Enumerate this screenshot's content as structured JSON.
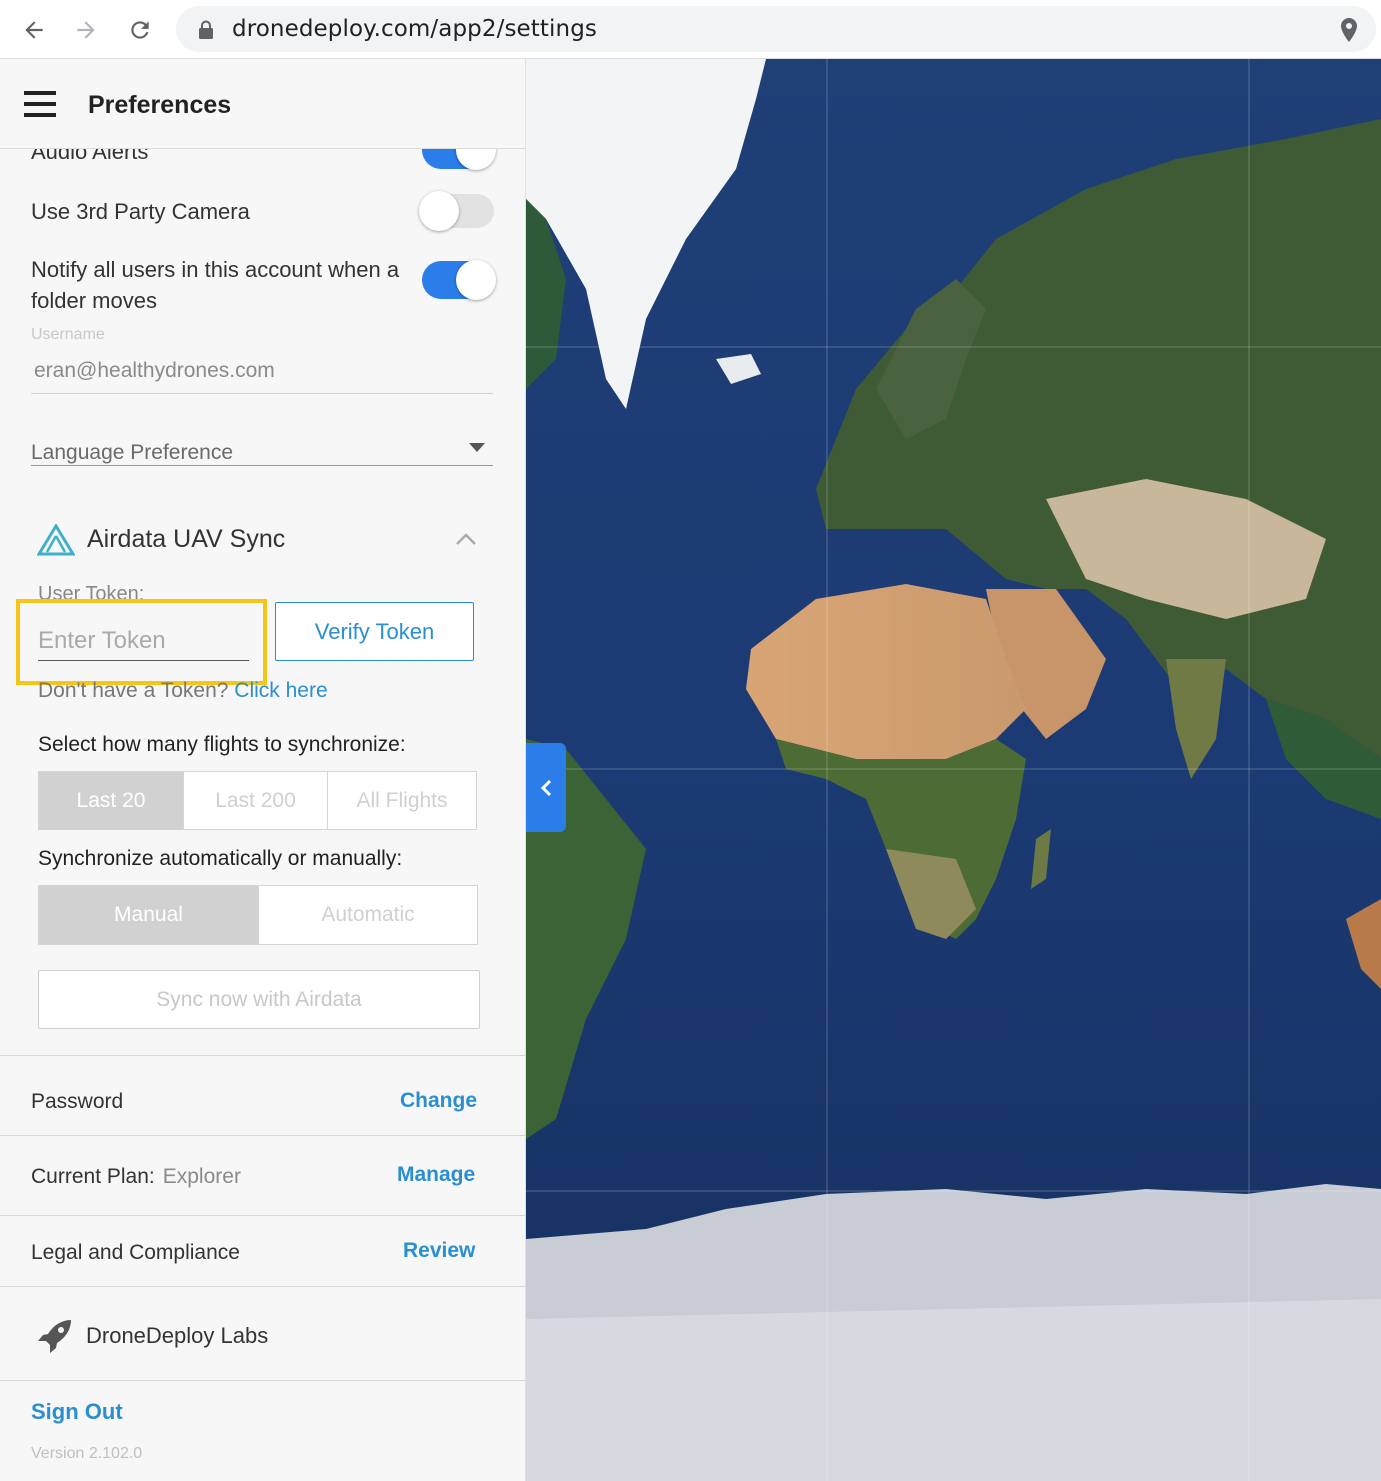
{
  "browser": {
    "url": "dronedeploy.com/app2/settings"
  },
  "header": {
    "title": "Preferences"
  },
  "preferences": {
    "audio_alerts": {
      "label": "Audio Alerts",
      "enabled": true
    },
    "third_party_camera": {
      "label": "Use 3rd Party Camera",
      "enabled": false
    },
    "notify_users": {
      "label_line1": "Notify all users in this account when a",
      "label_line2": "folder moves",
      "enabled": true
    },
    "username": {
      "caption": "Username",
      "value": "eran@healthydrones.com"
    },
    "language": {
      "label": "Language Preference"
    }
  },
  "airdata": {
    "title": "Airdata UAV Sync",
    "token_caption": "User Token:",
    "token_placeholder": "Enter Token",
    "verify_label": "Verify Token",
    "no_token_text": "Don't have a Token?",
    "click_here": "Click here",
    "flights_label": "Select how many flights to synchronize:",
    "flight_options": [
      "Last 20",
      "Last 200",
      "All Flights"
    ],
    "flight_selected": "Last 20",
    "mode_label": "Synchronize automatically or manually:",
    "mode_options": [
      "Manual",
      "Automatic"
    ],
    "mode_selected": "Manual",
    "sync_now": "Sync now with Airdata"
  },
  "account": {
    "password": {
      "label": "Password",
      "action": "Change"
    },
    "plan": {
      "label": "Current Plan:",
      "value": "Explorer",
      "action": "Manage"
    },
    "legal": {
      "label": "Legal and Compliance",
      "action": "Review"
    },
    "labs": {
      "label": "DroneDeploy Labs"
    }
  },
  "footer": {
    "sign_out": "Sign Out",
    "version": "Version 2.102.0"
  },
  "colors": {
    "accent": "#2a8fd0",
    "toggle_on": "#2b7de9",
    "highlight": "#f5c518"
  }
}
